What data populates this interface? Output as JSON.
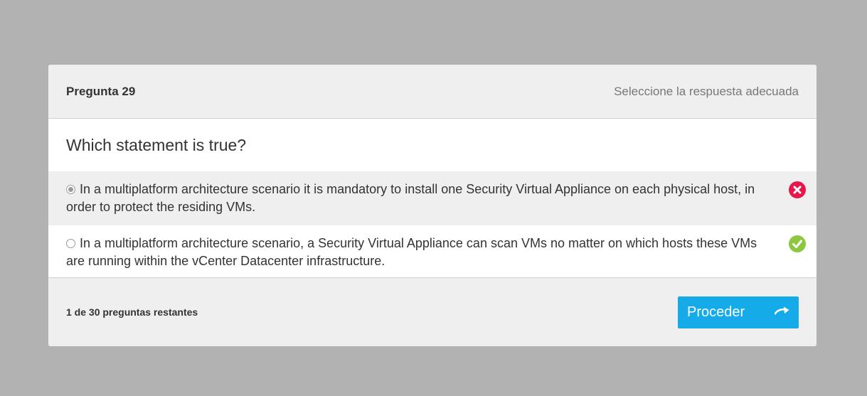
{
  "header": {
    "question_number": "Pregunta 29",
    "instruction": "Seleccione la respuesta adecuada"
  },
  "question": {
    "text": "Which statement is true?"
  },
  "options": [
    {
      "text": "In a multiplatform architecture scenario it is mandatory to install one Security Virtual Appliance on each physical host, in order to protect the residing VMs.",
      "selected": true,
      "status": "incorrect",
      "status_icon": "x-circle-icon",
      "status_color": "#e8174a"
    },
    {
      "text": "In a multiplatform architecture scenario, a Security Virtual Appliance can scan VMs no matter on which hosts these VMs are running within the vCenter Datacenter infrastructure.",
      "selected": false,
      "status": "correct",
      "status_icon": "check-circle-icon",
      "status_color": "#8dc63f"
    }
  ],
  "footer": {
    "remaining": "1 de 30 preguntas restantes",
    "proceed_label": "Proceder",
    "proceed_icon": "arrow-right-icon",
    "accent_color": "#15abe8"
  }
}
